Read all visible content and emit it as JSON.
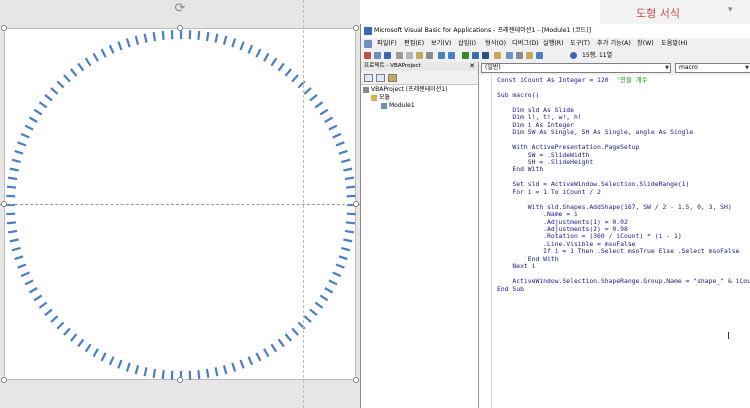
{
  "powerpoint": {
    "format_pane_title": "도형 서식",
    "format_pane_arrow": "▾",
    "rotate_glyph": "⟳"
  },
  "vbe": {
    "title": "Microsoft Visual Basic for Applications - 프레젠테이션1 - [Module1 (코드)]",
    "menu": [
      "파일(F)",
      "편집(E)",
      "보기(V)",
      "삽입(I)",
      "형식(O)",
      "디버그(D)",
      "실행(R)",
      "도구(T)",
      "추가 기능(A)",
      "창(W)",
      "도움말(H)"
    ],
    "toolbar_position": "15행, 11열",
    "project_panel": {
      "title": "프로젝트 - VBAProject",
      "close": "✕",
      "tree": [
        "VBAProject (프레젠테이션1)",
        "모듈",
        "Module1"
      ]
    },
    "code_combo_left": "(일반)",
    "code_combo_right": "macro",
    "code_lines": [
      "Const iCount As Integer = 120  '만들 개수",
      "",
      "Sub macro()",
      "",
      "    Dim sld As Slide",
      "    Dim l!, t!, w!, h!",
      "    Dim i As Integer",
      "    Dim SW As Single, SH As Single, angle As Single",
      "",
      "    With ActivePresentation.PageSetup",
      "        SW = .SlideWidth",
      "        SH = .SlideHeight",
      "    End With",
      "",
      "    Set sld = ActiveWindow.Selection.SlideRange(1)",
      "    For i = 1 To iCount / 2",
      "",
      "        With sld.Shapes.AddShape(167, SW / 2 - 1.5, 0, 3, SH)",
      "            .Name = i",
      "            .Adjustments(1) = 0.02",
      "            .Adjustments(2) = 0.98",
      "            .Rotation = (360 / iCount) * (i - 1)",
      "            .Line.Visible = msoFalse",
      "            If i = 1 Then .Select msoTrue Else .Select msoFalse",
      "        End With",
      "    Next i",
      "",
      "    ActiveWindow.Selection.ShapeRange.Group.Name = \"shape_\" & iCount",
      "End Sub"
    ],
    "cursor_glyph": "I"
  },
  "colors": {
    "tick": "#4a7fc4",
    "code_keyword": "#1a1a8a",
    "comment": "#1a8a1a",
    "accent_title": "#c0504d"
  },
  "shape": {
    "tick_count": 120
  }
}
